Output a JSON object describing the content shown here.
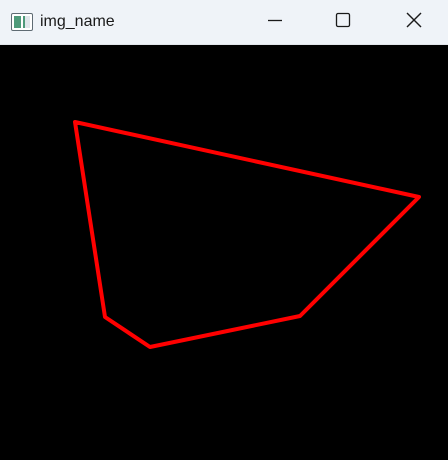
{
  "window": {
    "title": "img_name",
    "buttons": {
      "minimize": "minimize-icon",
      "maximize": "maximize-icon",
      "close": "close-icon"
    }
  },
  "canvas": {
    "background": "#000000",
    "shape": {
      "type": "closed-polygon",
      "stroke": "#ff0000",
      "fill": "none"
    }
  }
}
